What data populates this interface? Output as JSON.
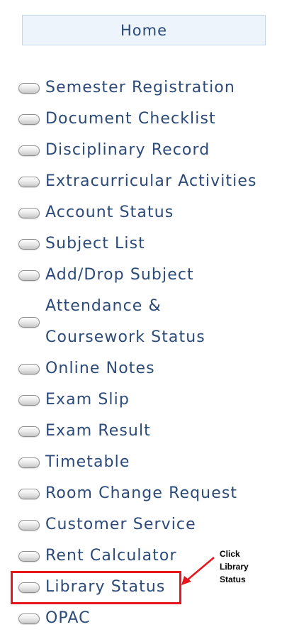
{
  "home_label": "Home",
  "menu": [
    {
      "label": "Semester Registration"
    },
    {
      "label": "Document Checklist"
    },
    {
      "label": "Disciplinary Record"
    },
    {
      "label": "Extracurricular Activities"
    },
    {
      "label": "Account Status"
    },
    {
      "label": "Subject List"
    },
    {
      "label": "Add/Drop Subject"
    },
    {
      "label_line1": "Attendance &",
      "label_line2": "Coursework Status"
    },
    {
      "label": "Online Notes"
    },
    {
      "label": "Exam Slip"
    },
    {
      "label": "Exam Result"
    },
    {
      "label": "Timetable"
    },
    {
      "label": "Room Change Request"
    },
    {
      "label": "Customer Service"
    },
    {
      "label": "Rent Calculator"
    },
    {
      "label": "Library Status"
    },
    {
      "label": "OPAC"
    }
  ],
  "callout": {
    "line1": "Click",
    "line2": "Library",
    "line3": "Status"
  },
  "colors": {
    "link": "#2b4a78",
    "highlight": "#e8141e",
    "home_bg": "#eef4fc"
  },
  "icons": {
    "bullet": "pill-bullet-icon",
    "arrow": "red-arrow-icon"
  }
}
